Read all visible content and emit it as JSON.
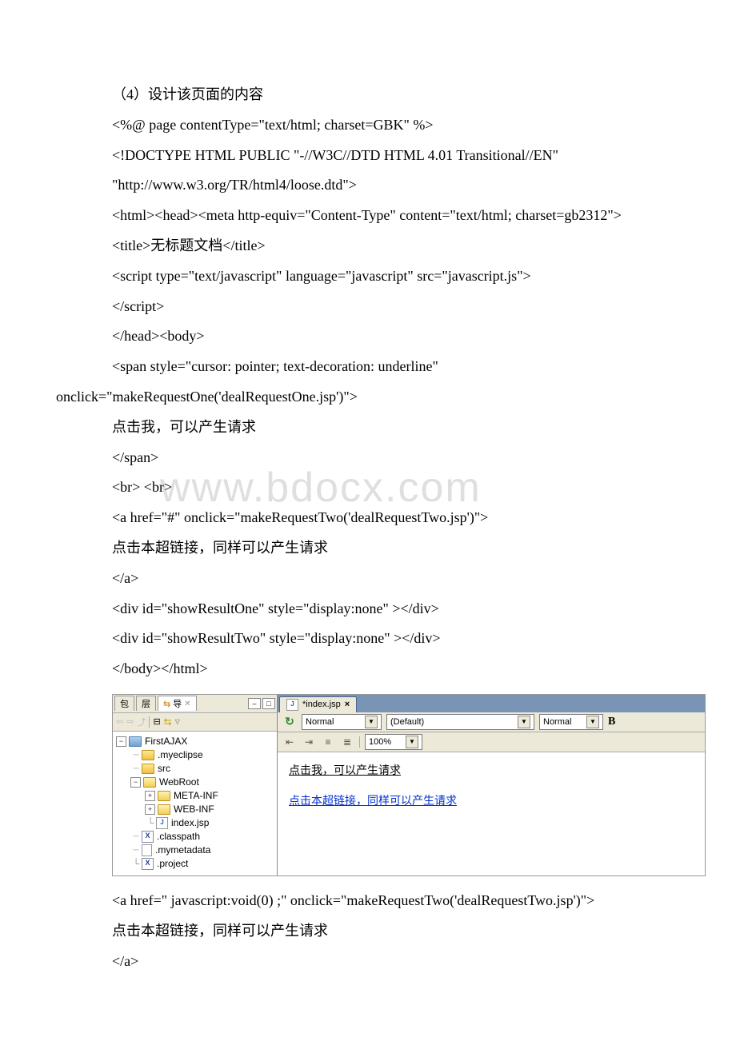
{
  "doc": {
    "heading4": "（4）设计该页面的内容",
    "l1": "<%@ page contentType=\"text/html; charset=GBK\" %>",
    "l2": "<!DOCTYPE HTML PUBLIC \"-//W3C//DTD HTML 4.01 Transitional//EN\"",
    "l3": "\"http://www.w3.org/TR/html4/loose.dtd\">",
    "l4": "<html><head><meta http-equiv=\"Content-Type\" content=\"text/html; charset=gb2312\">",
    "l5": "<title>无标题文档</title>",
    "l6": "<script type=\"text/javascript\" language=\"javascript\" src=\"javascript.js\">",
    "l7": "</script>",
    "l8": "</head><body>",
    "l9a": "<span style=\"cursor: pointer; text-decoration: underline\"",
    "l9b": "onclick=\"makeRequestOne('dealRequestOne.jsp')\">",
    "l10": " 点击我，可以产生请求",
    "l11": "</span>",
    "l12": " <br> <br>",
    "l13": "<a href=\"#\" onclick=\"makeRequestTwo('dealRequestTwo.jsp')\">",
    "l14": " 点击本超链接，同样可以产生请求",
    "l15": "</a>",
    "l16": "<div id=\"showResultOne\" style=\"display:none\" ></div>",
    "l17": "<div id=\"showResultTwo\" style=\"display:none\" ></div>",
    "l18": "</body></html>",
    "post1": "<a href=\" javascript:void(0) ;\" onclick=\"makeRequestTwo('dealRequestTwo.jsp')\">",
    "post2": " 点击本超链接，同样可以产生请求",
    "post3": "</a>",
    "watermark": "www.bdocx.com"
  },
  "ide": {
    "left": {
      "tab_pkg": "包",
      "tab_layer": "层",
      "tab_nav": "导",
      "nav_close": "✕",
      "tree": {
        "root": "FirstAJAX",
        "n1": ".myeclipse",
        "n2": "src",
        "n3": "WebRoot",
        "n3a": "META-INF",
        "n3b": "WEB-INF",
        "n3c": "index.jsp",
        "n4": ".classpath",
        "n5": ".mymetadata",
        "n6": ".project"
      }
    },
    "right": {
      "tab": "*index.jsp",
      "combo1": "Normal",
      "combo2": "(Default)",
      "combo3": "Normal",
      "zoom": "100%",
      "link1": "点击我，可以产生请求",
      "link2": "点击本超链接，同样可以产生请求"
    }
  }
}
